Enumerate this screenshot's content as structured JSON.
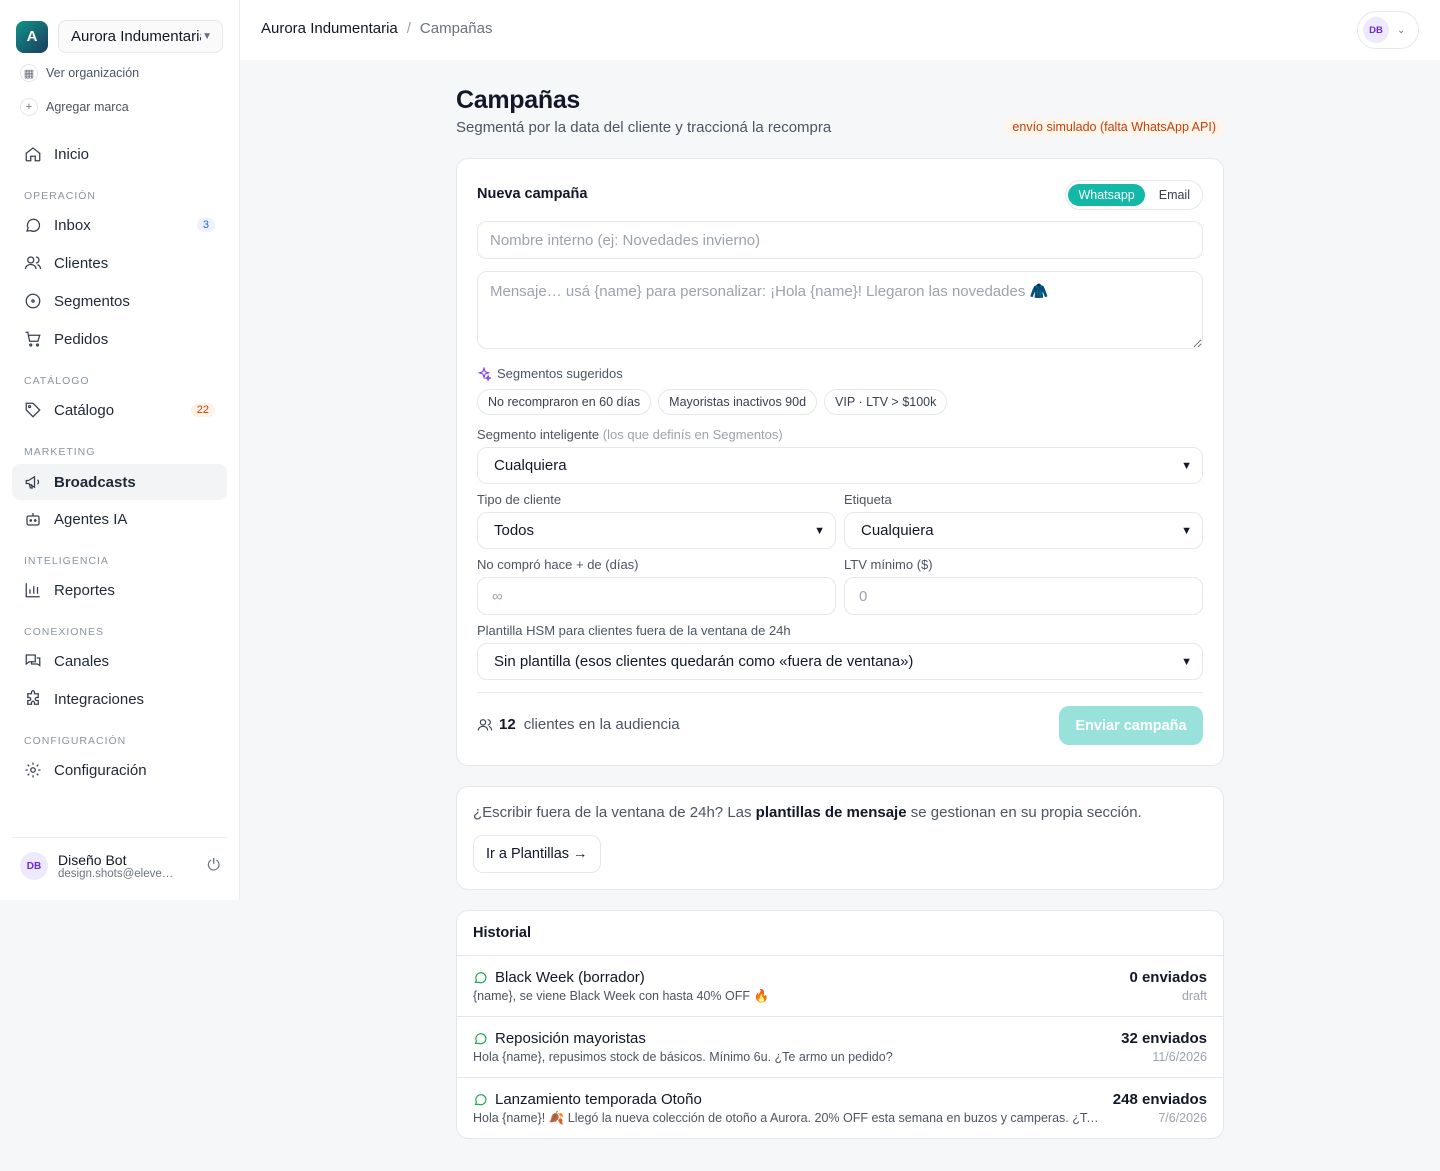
{
  "sidebar": {
    "org_initial": "A",
    "org_name": "Aurora Indumentaria",
    "links": {
      "view_org": "Ver organización",
      "add_brand": "Agregar marca"
    },
    "home": "Inicio",
    "sections": {
      "operacion": "OPERACIÓN",
      "catalogo": "CATÁLOGO",
      "marketing": "MARKETING",
      "inteligencia": "INTELIGENCIA",
      "conexiones": "CONEXIONES",
      "configuracion": "CONFIGURACIÓN"
    },
    "items": {
      "inbox": "Inbox",
      "inbox_badge": "3",
      "clientes": "Clientes",
      "segmentos": "Segmentos",
      "pedidos": "Pedidos",
      "catalogo": "Catálogo",
      "catalogo_badge": "22",
      "broadcasts": "Broadcasts",
      "agentes": "Agentes IA",
      "reportes": "Reportes",
      "canales": "Canales",
      "integraciones": "Integraciones",
      "configuracion": "Configuración"
    },
    "user": {
      "initials": "DB",
      "name": "Diseño Bot",
      "email": "design.shots@eleventa.dev"
    }
  },
  "topbar": {
    "org": "Aurora Indumentaria",
    "separator": "/",
    "current": "Campañas",
    "user_initials": "DB"
  },
  "page": {
    "title": "Campañas",
    "subtitle": "Segmentá por la data del cliente y traccioná la recompra",
    "sim_badge": "envío simulado (falta WhatsApp API)"
  },
  "form": {
    "title": "Nueva campaña",
    "channels": {
      "whatsapp": "Whatsapp",
      "email": "Email"
    },
    "name_placeholder": "Nombre interno (ej: Novedades invierno)",
    "message_placeholder": "Mensaje… usá {name} para personalizar: ¡Hola {name}! Llegaron las novedades 🧥",
    "suggested_label": "Segmentos sugeridos",
    "chips": [
      "No recompraron en 60 días",
      "Mayoristas inactivos 90d",
      "VIP · LTV > $100k"
    ],
    "smart_segment_label": "Segmento inteligente",
    "smart_segment_hint": "(los que definís en Segmentos)",
    "smart_segment_value": "Cualquiera",
    "client_type_label": "Tipo de cliente",
    "client_type_value": "Todos",
    "tag_label": "Etiqueta",
    "tag_value": "Cualquiera",
    "days_label": "No compró hace + de (días)",
    "days_placeholder": "∞",
    "ltv_label": "LTV mínimo ($)",
    "ltv_placeholder": "0",
    "hsm_label": "Plantilla HSM para clientes fuera de la ventana de 24h",
    "hsm_value": "Sin plantilla (esos clientes quedarán como «fuera de ventana»)",
    "audience_count": "12",
    "audience_text": "clientes en la audiencia",
    "send_label": "Enviar campaña"
  },
  "templates_card": {
    "text_before": "¿Escribir fuera de la ventana de 24h? Las ",
    "text_bold": "plantillas de mensaje",
    "text_after": " se gestionan en su propia sección.",
    "button": "Ir a Plantillas →"
  },
  "history": {
    "title": "Historial",
    "rows": [
      {
        "title": "Black Week (borrador)",
        "message": "{name}, se viene Black Week con hasta 40% OFF 🔥",
        "count": "0 enviados",
        "date": "draft"
      },
      {
        "title": "Reposición mayoristas",
        "message": "Hola {name}, repusimos stock de básicos. Mínimo 6u. ¿Te armo un pedido?",
        "count": "32 enviados",
        "date": "11/6/2026"
      },
      {
        "title": "Lanzamiento temporada Otoño",
        "message": "Hola {name}! 🍂 Llegó la nueva colección de otoño a Aurora. 20% OFF esta semana en buzos y camperas. ¿Te paso el catálogo?",
        "count": "248 enviados",
        "date": "7/6/2026"
      }
    ]
  }
}
